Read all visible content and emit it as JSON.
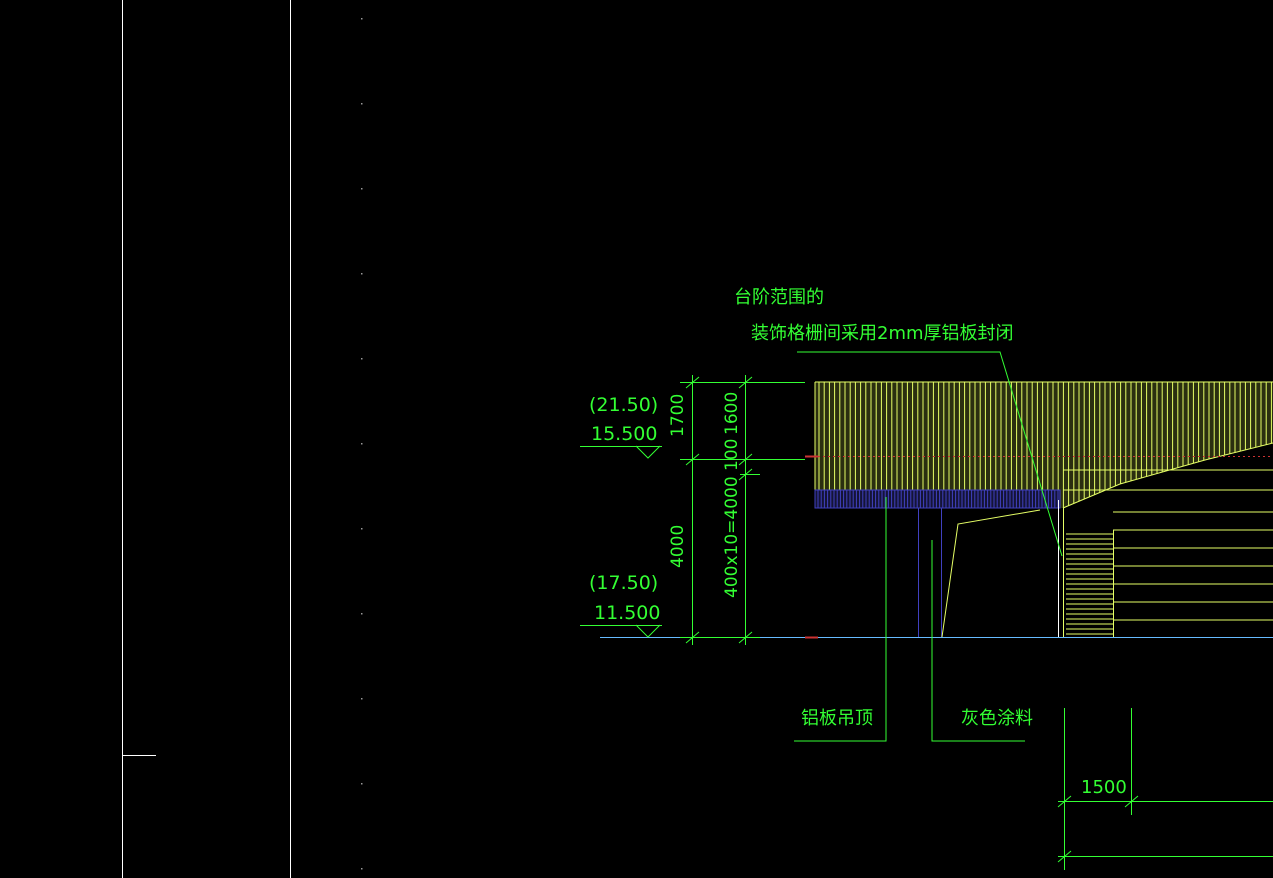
{
  "annotations": {
    "note_line1": "台阶范围的",
    "note_line2": "装饰格栅间采用2mm厚铝板封闭",
    "ceiling_label": "铝板吊顶",
    "paint_label": "灰色涂料"
  },
  "elevations": {
    "upper_paren": "(21.50)",
    "upper_value": "15.500",
    "lower_paren": "(17.50)",
    "lower_value": "11.500"
  },
  "dimensions": {
    "d1700": "1700",
    "d1600": "1600",
    "d100": "100",
    "d4000": "4000",
    "d400x10": "400x10=4000",
    "d1500": "1500"
  },
  "colors": {
    "background": "#000000",
    "annotation": "#33ff33",
    "grille": "#e6ff66",
    "blue_band": "#4040c0",
    "outline": "#ffffff"
  }
}
